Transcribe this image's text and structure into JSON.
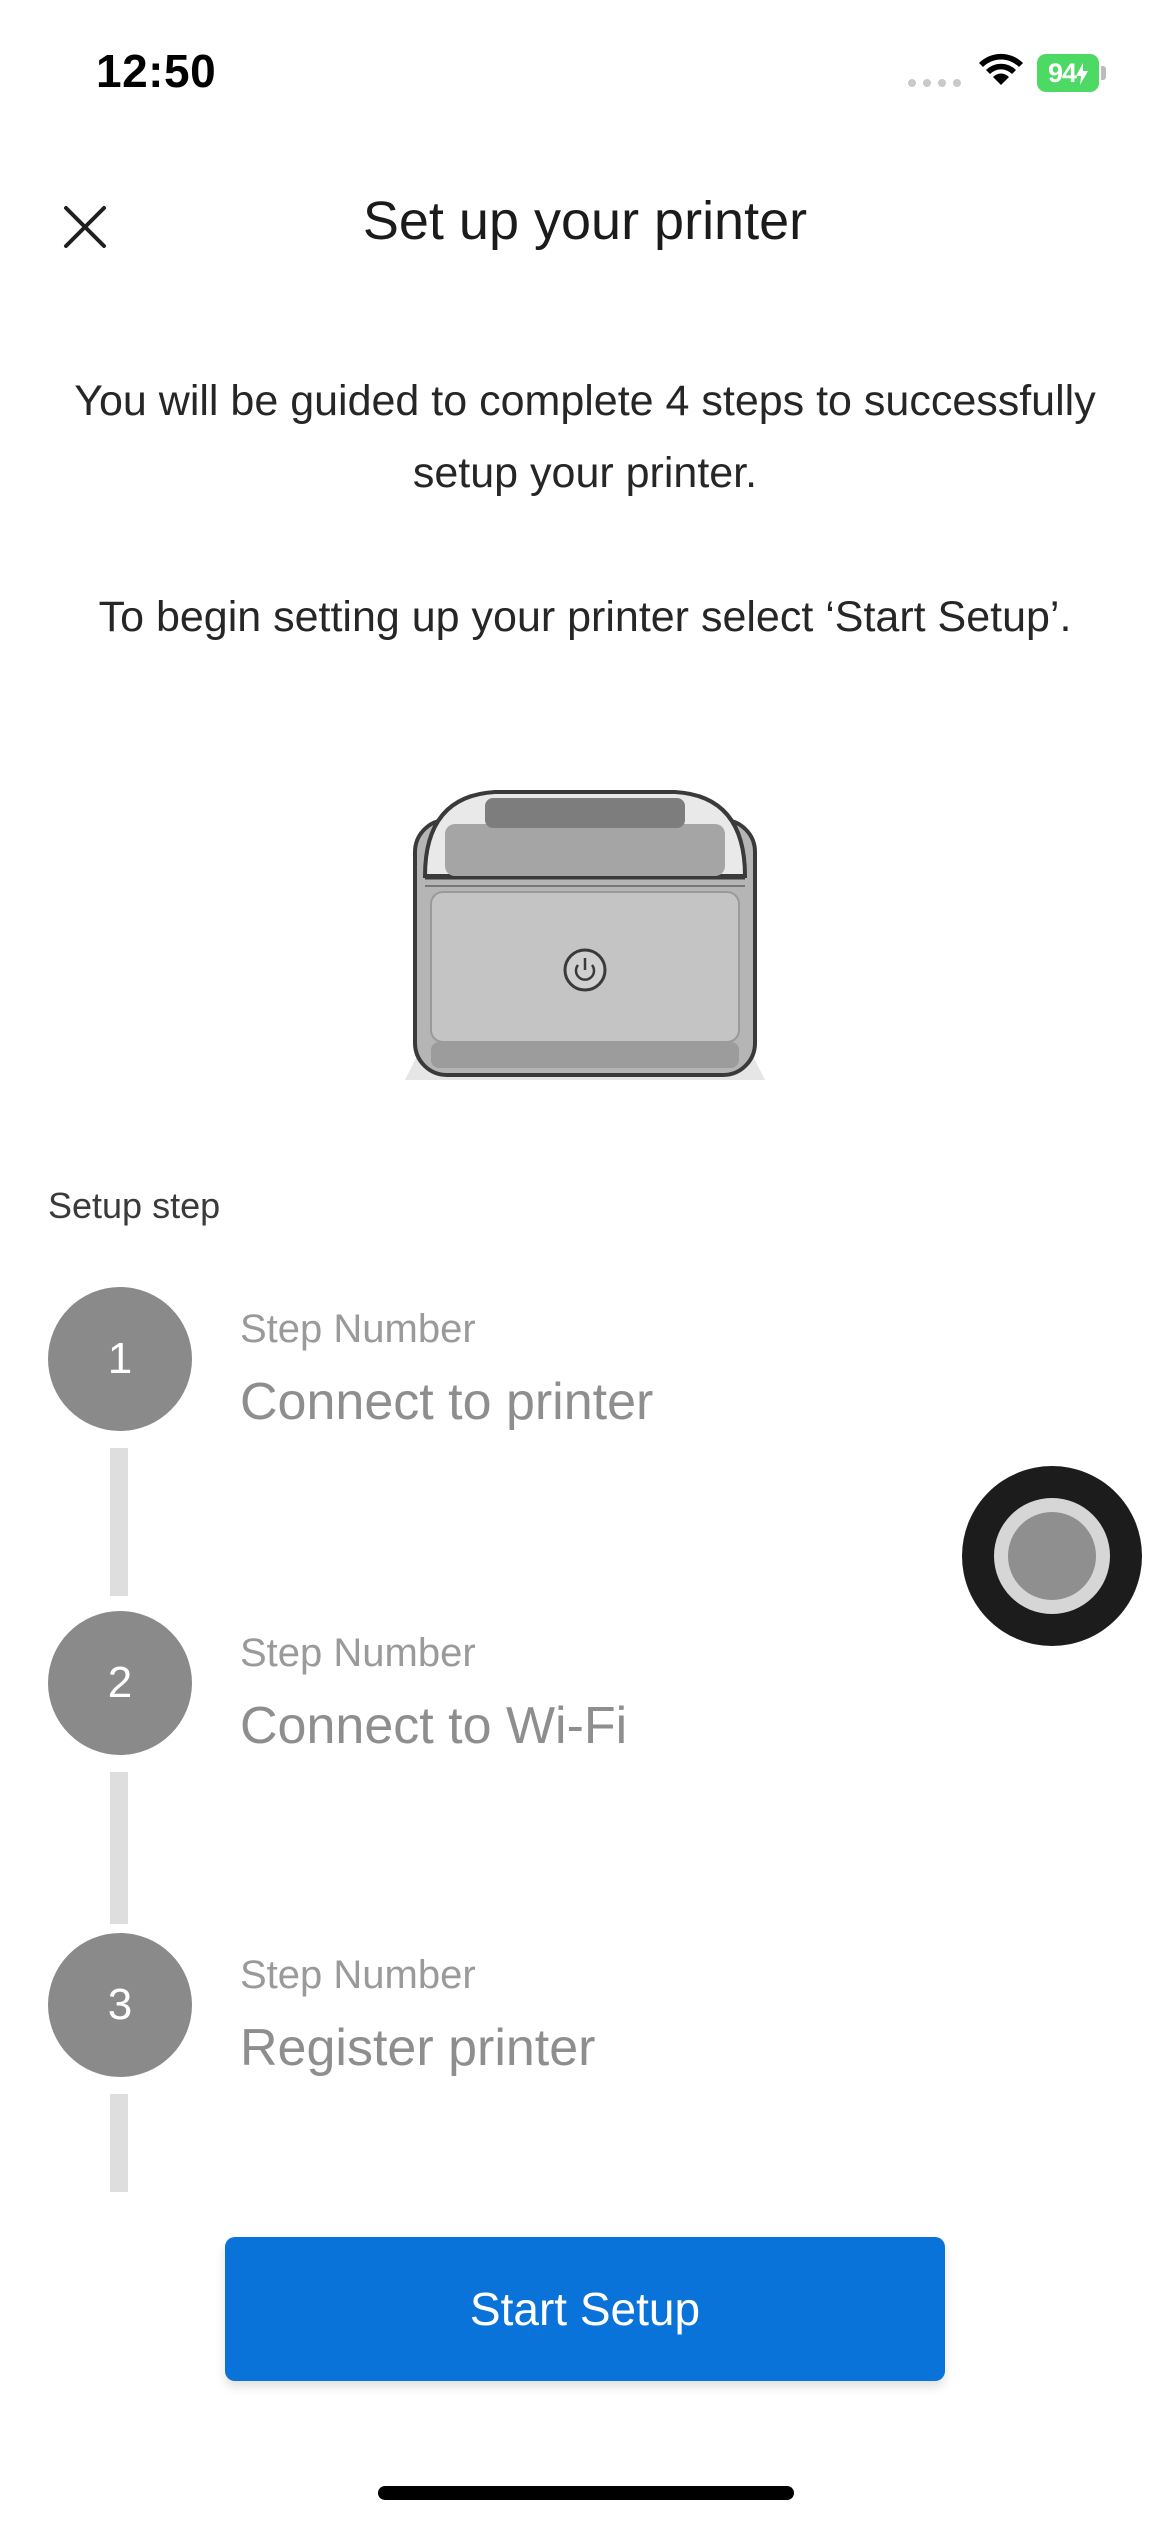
{
  "status_bar": {
    "time": "12:50",
    "battery": "94"
  },
  "header": {
    "title": "Set up your printer",
    "close_icon": "close-icon"
  },
  "intro": {
    "paragraph1": "You will be guided to complete 4 steps to successfully setup your printer.",
    "paragraph2": "To begin setting up your printer select ‘Start Setup’."
  },
  "setup": {
    "section_label": "Setup step",
    "steps": [
      {
        "number": "1",
        "caption": "Step Number",
        "title": "Connect to printer"
      },
      {
        "number": "2",
        "caption": "Step Number",
        "title": "Connect to Wi-Fi"
      },
      {
        "number": "3",
        "caption": "Step Number",
        "title": "Register printer"
      }
    ]
  },
  "actions": {
    "start_label": "Start Setup"
  },
  "colors": {
    "primary": "#0a73d9",
    "step_circle": "#8a8a8a",
    "battery": "#4cd964"
  }
}
